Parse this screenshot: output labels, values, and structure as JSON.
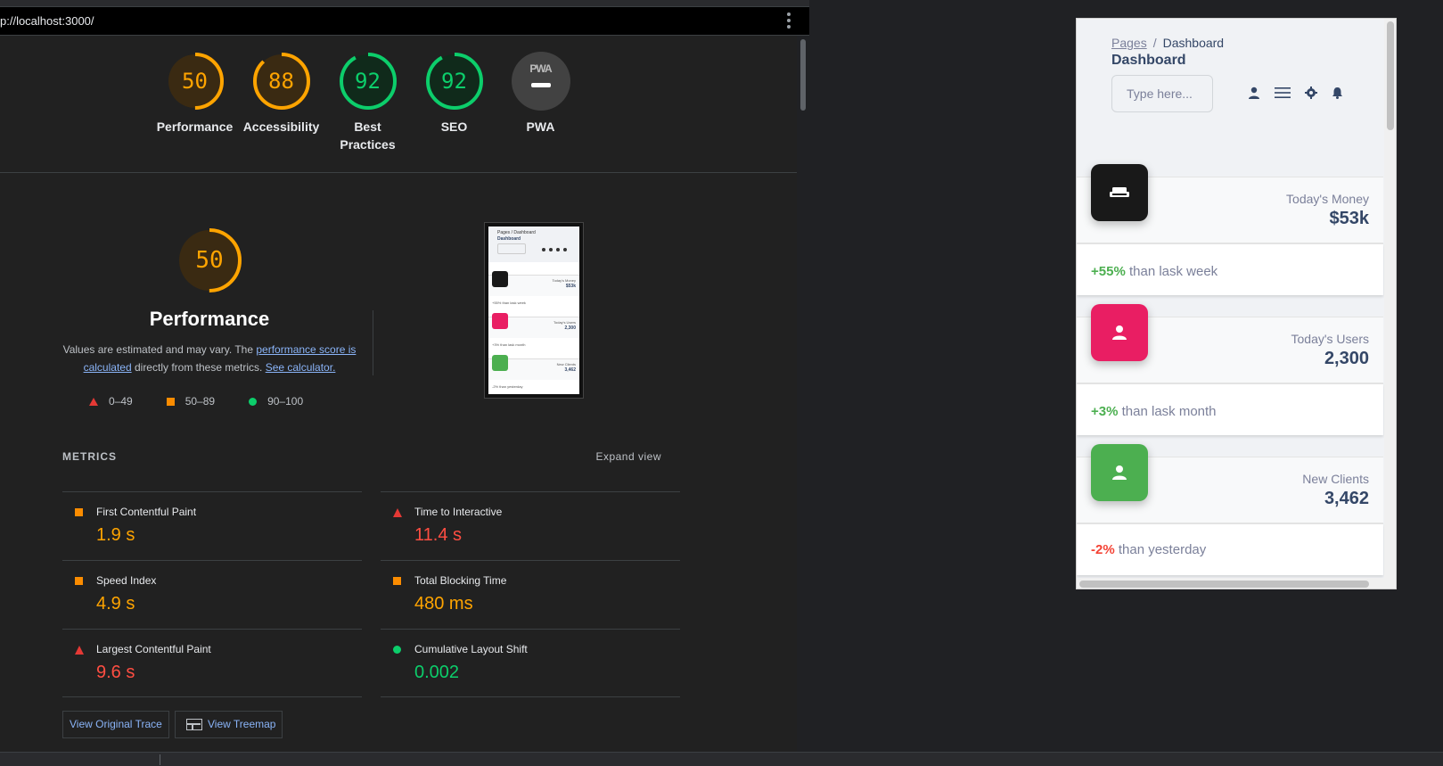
{
  "browser": {
    "url": "p://localhost:3000/"
  },
  "colors": {
    "pass": "#0cce6b",
    "average": "#ffa400",
    "fail": "#ff4e42",
    "dark_icon": "#191919",
    "pink_icon": "#e91e63",
    "green_icon": "#4caf50"
  },
  "scores": [
    {
      "label": "Performance",
      "value": "50",
      "rating": "average"
    },
    {
      "label": "Accessibility",
      "value": "88",
      "rating": "average"
    },
    {
      "label": "Best Practices",
      "value": "92",
      "rating": "pass"
    },
    {
      "label": "SEO",
      "value": "92",
      "rating": "pass"
    },
    {
      "label": "PWA",
      "value": "",
      "rating": "na",
      "badge": "PWA"
    }
  ],
  "performance": {
    "score": "50",
    "title": "Performance",
    "desc_prefix": "Values are estimated and may vary. The ",
    "desc_link": "performance score is calculated",
    "desc_middle": " directly from these metrics. ",
    "desc_link2": "See calculator.",
    "legend": [
      "0–49",
      "50–89",
      "90–100"
    ]
  },
  "metrics": {
    "title": "METRICS",
    "expand": "Expand view",
    "items": [
      {
        "name": "First Contentful Paint",
        "value": "1.9 s",
        "rating": "average"
      },
      {
        "name": "Time to Interactive",
        "value": "11.4 s",
        "rating": "fail"
      },
      {
        "name": "Speed Index",
        "value": "4.9 s",
        "rating": "average"
      },
      {
        "name": "Total Blocking Time",
        "value": "480 ms",
        "rating": "average"
      },
      {
        "name": "Largest Contentful Paint",
        "value": "9.6 s",
        "rating": "fail"
      },
      {
        "name": "Cumulative Layout Shift",
        "value": "0.002",
        "rating": "pass"
      }
    ],
    "buttons": {
      "trace": "View Original Trace",
      "treemap": "View Treemap"
    }
  },
  "thumbnail": {
    "crumb": "Pages / Dashboard",
    "title": "Dashboard",
    "input": "Type here...",
    "cards": [
      {
        "label": "Today's Money",
        "value": "$53k",
        "foot": "+55% than lask week"
      },
      {
        "label": "Today's Users",
        "value": "2,300",
        "foot": "+3% than lask month"
      },
      {
        "label": "New Clients",
        "value": "3,462",
        "foot": "-2% than yesterday"
      }
    ]
  },
  "device": {
    "breadcrumb_link": "Pages",
    "breadcrumb_sep": "/",
    "breadcrumb_current": "Dashboard",
    "title": "Dashboard",
    "search_placeholder": "Type here...",
    "cards": [
      {
        "label": "Today's Money",
        "value": "$53k",
        "change": "+55%",
        "change_text": " than lask week",
        "icon": "sofa-icon",
        "trend": "pos"
      },
      {
        "label": "Today's Users",
        "value": "2,300",
        "change": "+3%",
        "change_text": " than lask month",
        "icon": "person-icon",
        "trend": "pos"
      },
      {
        "label": "New Clients",
        "value": "3,462",
        "change": "-2%",
        "change_text": " than yesterday",
        "icon": "person-icon",
        "trend": "neg"
      }
    ]
  }
}
